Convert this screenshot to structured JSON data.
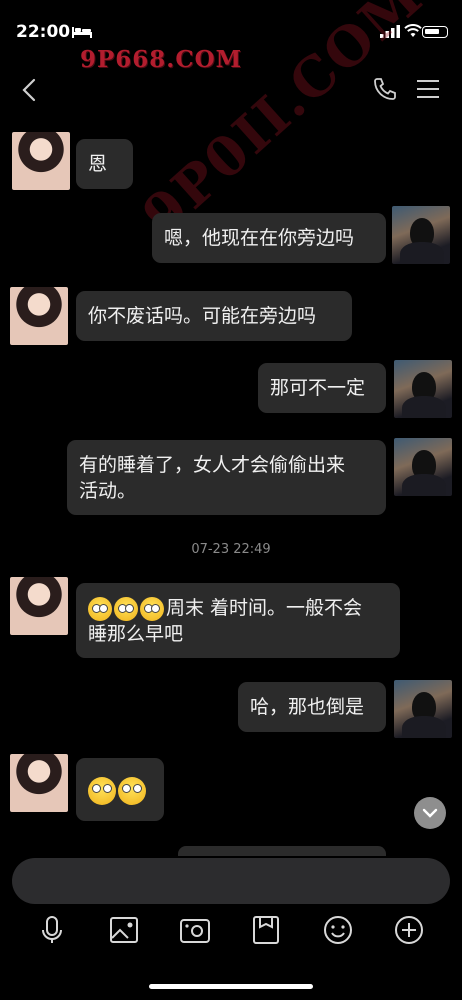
{
  "status_bar": {
    "time": "22:00"
  },
  "watermark": {
    "top": "9P668.COM",
    "diagonal": "9P0II.COM"
  },
  "messages": [
    {
      "side": "left",
      "text": "恩"
    },
    {
      "side": "right",
      "text": "嗯，他现在在你旁边吗"
    },
    {
      "side": "left",
      "text": "你不废话吗。可能在旁边吗"
    },
    {
      "side": "right",
      "text": "那可不一定"
    },
    {
      "side": "right",
      "line1": "有的睡着了，女人才会偷偷出来",
      "line2": "活动。"
    },
    {
      "side": "left",
      "line1_text": "周末 着时间。一般不会",
      "line2": "睡那么早吧"
    },
    {
      "side": "right",
      "text": "哈，那也倒是"
    },
    {
      "side": "left",
      "emoji_only": true
    }
  ],
  "timestamp": "07-23 22:49",
  "icons": {
    "nav": [
      "back-arrow-icon",
      "phone-icon",
      "menu-icon"
    ],
    "toolbar": [
      "microphone-icon",
      "image-icon",
      "camera-icon",
      "file-icon",
      "emoji-icon",
      "plus-icon"
    ],
    "status": [
      "bed-icon",
      "signal-icon",
      "wifi-icon",
      "battery-icon"
    ]
  }
}
